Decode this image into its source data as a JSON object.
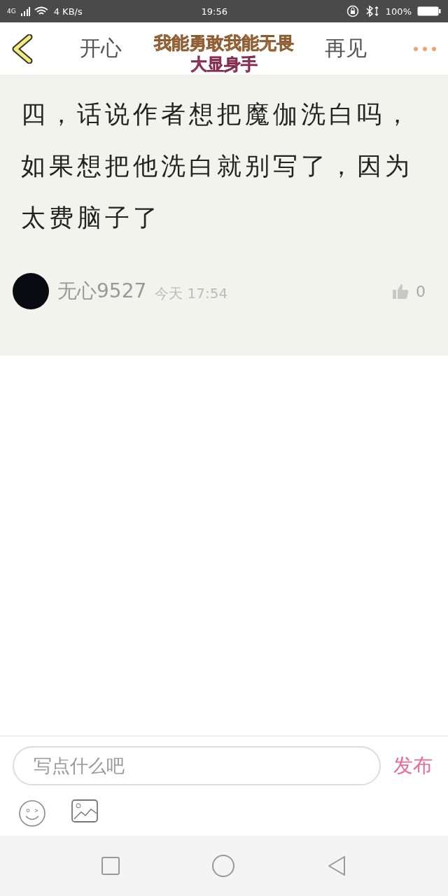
{
  "status_bar": {
    "network": "4G",
    "speed": "4 KB/s",
    "time": "19:56",
    "battery": "100%"
  },
  "header": {
    "title_start": "开心",
    "title_end": "再见",
    "overlay_line1": "我能勇敢我能无畏",
    "overlay_line2": "大显身手"
  },
  "post": {
    "text": "四，话说作者想把魔伽洗白吗，如果想把他洗白就别写了，因为太费脑子了",
    "author": "无心9527",
    "time": "今天 17:54",
    "likes": "0"
  },
  "composer": {
    "placeholder": "写点什么吧",
    "send": "发布"
  }
}
